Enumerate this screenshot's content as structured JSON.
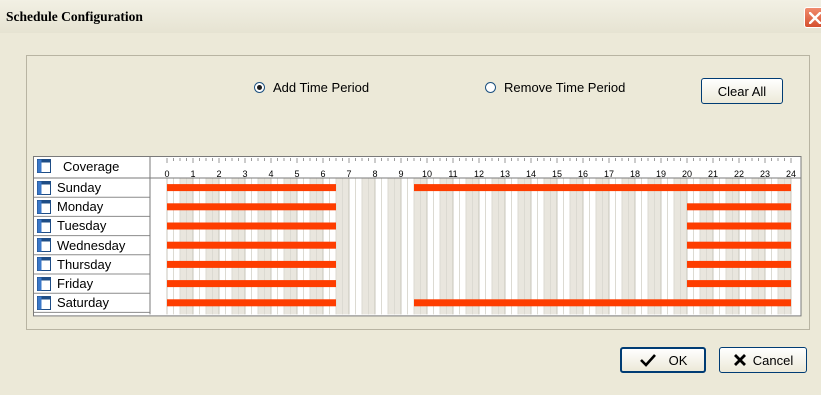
{
  "window": {
    "title": "Schedule Configuration"
  },
  "options": {
    "add_label": "Add Time Period",
    "remove_label": "Remove Time Period",
    "selected": "add",
    "clear_all": "Clear All"
  },
  "grid": {
    "coverage_label": "Coverage",
    "hours": [
      "0",
      "1",
      "2",
      "3",
      "4",
      "5",
      "6",
      "7",
      "8",
      "9",
      "10",
      "11",
      "12",
      "13",
      "14",
      "15",
      "16",
      "17",
      "18",
      "19",
      "20",
      "21",
      "22",
      "23",
      "24"
    ],
    "days": [
      {
        "name": "Sunday",
        "periods": [
          [
            0,
            6.5
          ],
          [
            9.5,
            24
          ]
        ]
      },
      {
        "name": "Monday",
        "periods": [
          [
            0,
            6.5
          ],
          [
            20,
            24
          ]
        ]
      },
      {
        "name": "Tuesday",
        "periods": [
          [
            0,
            6.5
          ],
          [
            20,
            24
          ]
        ]
      },
      {
        "name": "Wednesday",
        "periods": [
          [
            0,
            6.5
          ],
          [
            20,
            24
          ]
        ]
      },
      {
        "name": "Thursday",
        "periods": [
          [
            0,
            6.5
          ],
          [
            20,
            24
          ]
        ]
      },
      {
        "name": "Friday",
        "periods": [
          [
            0,
            6.5
          ],
          [
            20,
            24
          ]
        ]
      },
      {
        "name": "Saturday",
        "periods": [
          [
            0,
            6.5
          ],
          [
            9.5,
            24
          ]
        ]
      }
    ],
    "covered_color": "#fe3d00"
  },
  "footer": {
    "ok": "OK",
    "cancel": "Cancel"
  }
}
